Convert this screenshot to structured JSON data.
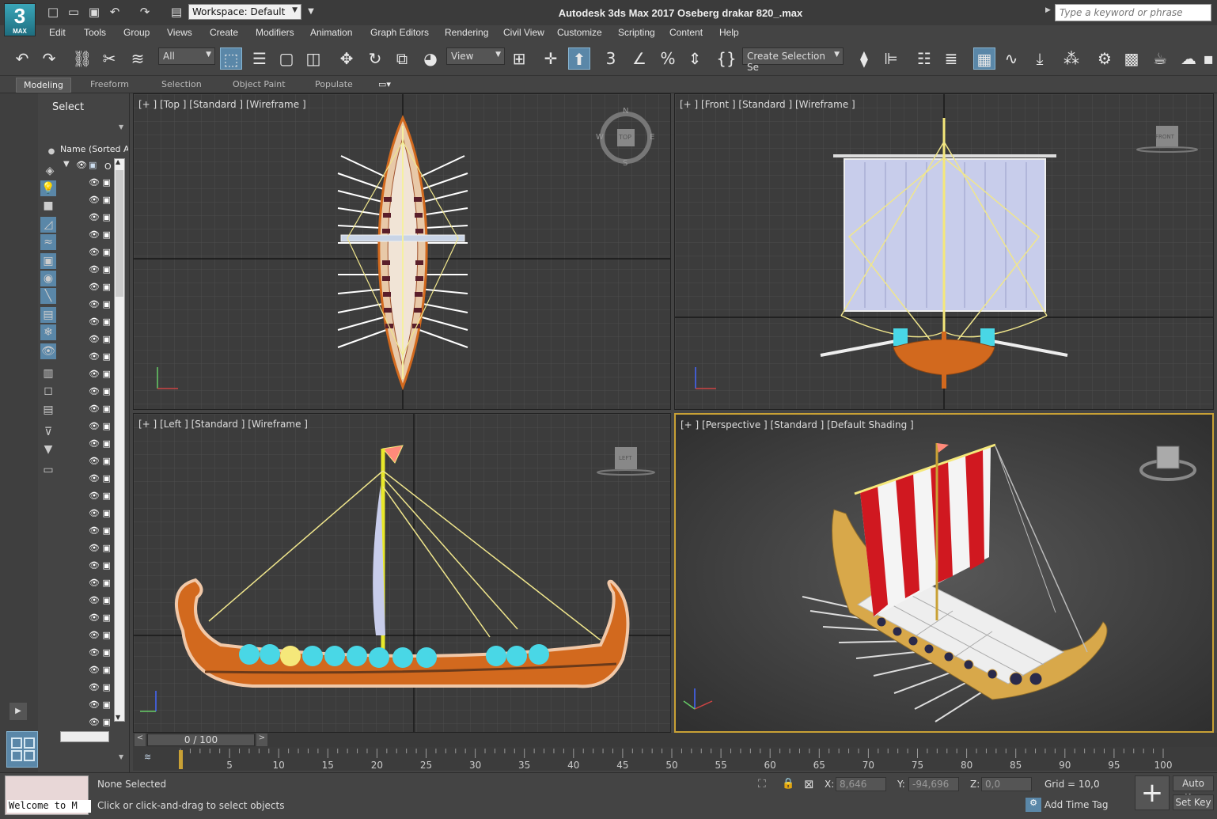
{
  "app": {
    "logo_text": "3",
    "logo_sub": "MAX",
    "title": "Autodesk 3ds Max 2017     Oseberg drakar 820_.max"
  },
  "workspace": {
    "label": "Workspace: Default"
  },
  "search": {
    "placeholder": "Type a keyword or phrase"
  },
  "menu": [
    "Edit",
    "Tools",
    "Group",
    "Views",
    "Create",
    "Modifiers",
    "Animation",
    "Graph Editors",
    "Rendering",
    "Civil View",
    "Customize",
    "Scripting",
    "Content",
    "Help"
  ],
  "toolbar": {
    "filter": "All",
    "refcoord": "View",
    "named_selection": "Create Selection Se"
  },
  "ribbon_tabs": [
    "Modeling",
    "Freeform",
    "Selection",
    "Object Paint",
    "Populate"
  ],
  "scene_explorer": {
    "title": "Select",
    "column": "Name (Sorted Asc",
    "first_item_prefix": "O"
  },
  "viewports": {
    "top": "[+ ] [Top ] [Standard ] [Wireframe ]",
    "front": "[+ ] [Front ] [Standard ] [Wireframe ]",
    "left": "[+ ] [Left ] [Standard ] [Wireframe ]",
    "perspective": "[+ ] [Perspective ] [Standard ] [Default Shading ]"
  },
  "viewcube": {
    "top_n": "N",
    "top_s": "S",
    "top_w": "W",
    "top_e": "E",
    "top_face": "TOP",
    "front_face": "FRONT",
    "left_face": "LEFT"
  },
  "time": {
    "slider": "0 / 100",
    "ticks": [
      "5",
      "10",
      "15",
      "20",
      "25",
      "30",
      "35",
      "40",
      "45",
      "50",
      "55",
      "60",
      "65",
      "70",
      "75",
      "80",
      "85",
      "90",
      "95",
      "100"
    ]
  },
  "status": {
    "maxscript": "Welcome to M",
    "selection": "None Selected",
    "prompt": "Click or click-and-drag to select objects",
    "x_label": "X:",
    "x_value": "8,646",
    "y_label": "Y:",
    "y_value": "-94,696",
    "z_label": "Z:",
    "z_value": "0,0",
    "grid": "Grid = 10,0",
    "add_time_tag": "Add Time Tag",
    "auto_key": "Auto Key",
    "set_key": "Set Key"
  },
  "colors": {
    "accent": "#5a87a8",
    "active_viewport": "#c9a135",
    "hull": "#d2691e",
    "sail_red": "#d01820",
    "shield": "#49d7e6"
  }
}
